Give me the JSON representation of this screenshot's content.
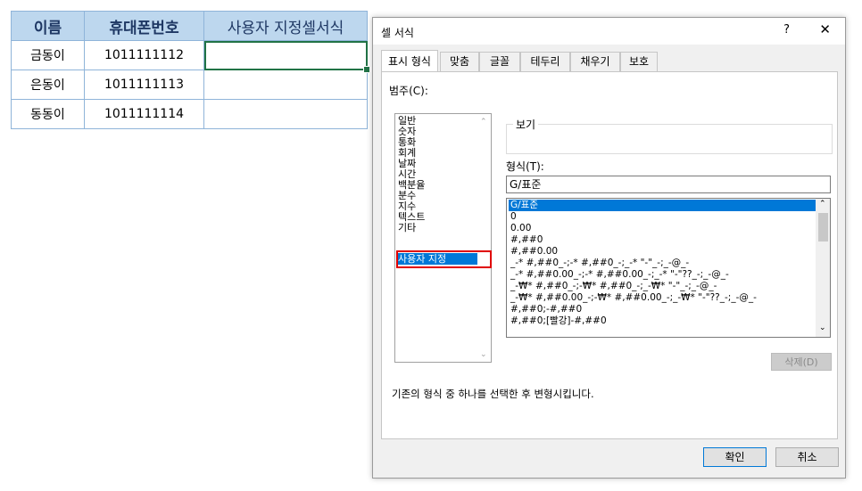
{
  "sheet": {
    "headers": [
      "이름",
      "휴대폰번호",
      "사용자 지정셀서식"
    ],
    "rows": [
      [
        "금동이",
        "1011111112",
        ""
      ],
      [
        "은동이",
        "1011111113",
        ""
      ],
      [
        "동동이",
        "1011111114",
        ""
      ]
    ]
  },
  "dialog": {
    "title": "셀 서식",
    "help": "?",
    "close": "✕",
    "tabs": [
      "표시 형식",
      "맞춤",
      "글꼴",
      "테두리",
      "채우기",
      "보호"
    ],
    "category_label": "범주(C):",
    "categories": [
      "일반",
      "숫자",
      "통화",
      "회계",
      "날짜",
      "시간",
      "백분율",
      "분수",
      "지수",
      "텍스트",
      "기타",
      "사용자 지정"
    ],
    "selected_category": "사용자 지정",
    "preview_label": "보기",
    "format_label": "형식(T):",
    "format_value": "G/표준",
    "format_list": [
      "G/표준",
      "0",
      "0.00",
      "#,##0",
      "#,##0.00",
      "_-* #,##0_-;-* #,##0_-;_-* \"-\"_-;_-@_-",
      "_-* #,##0.00_-;-* #,##0.00_-;_-* \"-\"??_-;_-@_-",
      "_-₩* #,##0_-;-₩* #,##0_-;_-₩* \"-\"_-;_-@_-",
      "_-₩* #,##0.00_-;-₩* #,##0.00_-;_-₩* \"-\"??_-;_-@_-",
      "#,##0;-#,##0",
      "#,##0;[빨강]-#,##0"
    ],
    "delete_label": "삭제(D)",
    "description": "기존의 형식 중 하나를 선택한 후 변형시킵니다.",
    "ok_label": "확인",
    "cancel_label": "취소",
    "colors": {
      "accent": "#0078d7",
      "highlight": "#e00000",
      "header_fill": "#bdd7ee"
    }
  }
}
